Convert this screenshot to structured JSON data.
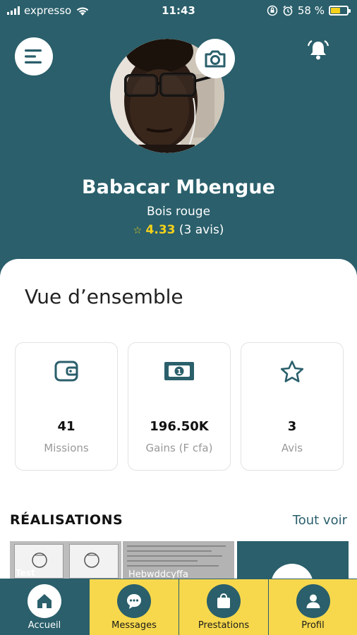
{
  "status_bar": {
    "carrier": "expresso",
    "time": "11:43",
    "battery_percent": "58 %",
    "battery_level": 0.58
  },
  "header": {
    "menu_icon": "menu-icon",
    "notification_icon": "bell-icon",
    "camera_icon": "camera-icon",
    "bg_color": "#2a5f6b"
  },
  "profile": {
    "name": "Babacar Mbengue",
    "location": "Bois rouge",
    "rating_icon": "star-outline-icon",
    "rating": "4.33",
    "reviews": "(3 avis)"
  },
  "overview": {
    "title": "Vue d’ensemble",
    "stats": [
      {
        "icon": "wallet-icon",
        "value": "41",
        "label": "Missions"
      },
      {
        "icon": "banknote-icon",
        "value": "196.50K",
        "label": "Gains (F cfa)"
      },
      {
        "icon": "star-icon",
        "value": "3",
        "label": "Avis"
      }
    ]
  },
  "realisations": {
    "title": "RÉALISATIONS",
    "see_all": "Tout voir",
    "items": [
      {
        "caption": "Test"
      },
      {
        "caption": "Hebwddcyffa"
      },
      {
        "caption": ""
      }
    ]
  },
  "bottom_nav": {
    "items": [
      {
        "label": "Accueil",
        "icon": "home-icon",
        "active": true
      },
      {
        "label": "Messages",
        "icon": "chat-icon",
        "active": false
      },
      {
        "label": "Prestations",
        "icon": "bag-icon",
        "active": false
      },
      {
        "label": "Profil",
        "icon": "user-icon",
        "active": false
      }
    ]
  },
  "colors": {
    "primary": "#2a5f6b",
    "accent": "#f7d84c",
    "rating": "#f5d11b"
  }
}
